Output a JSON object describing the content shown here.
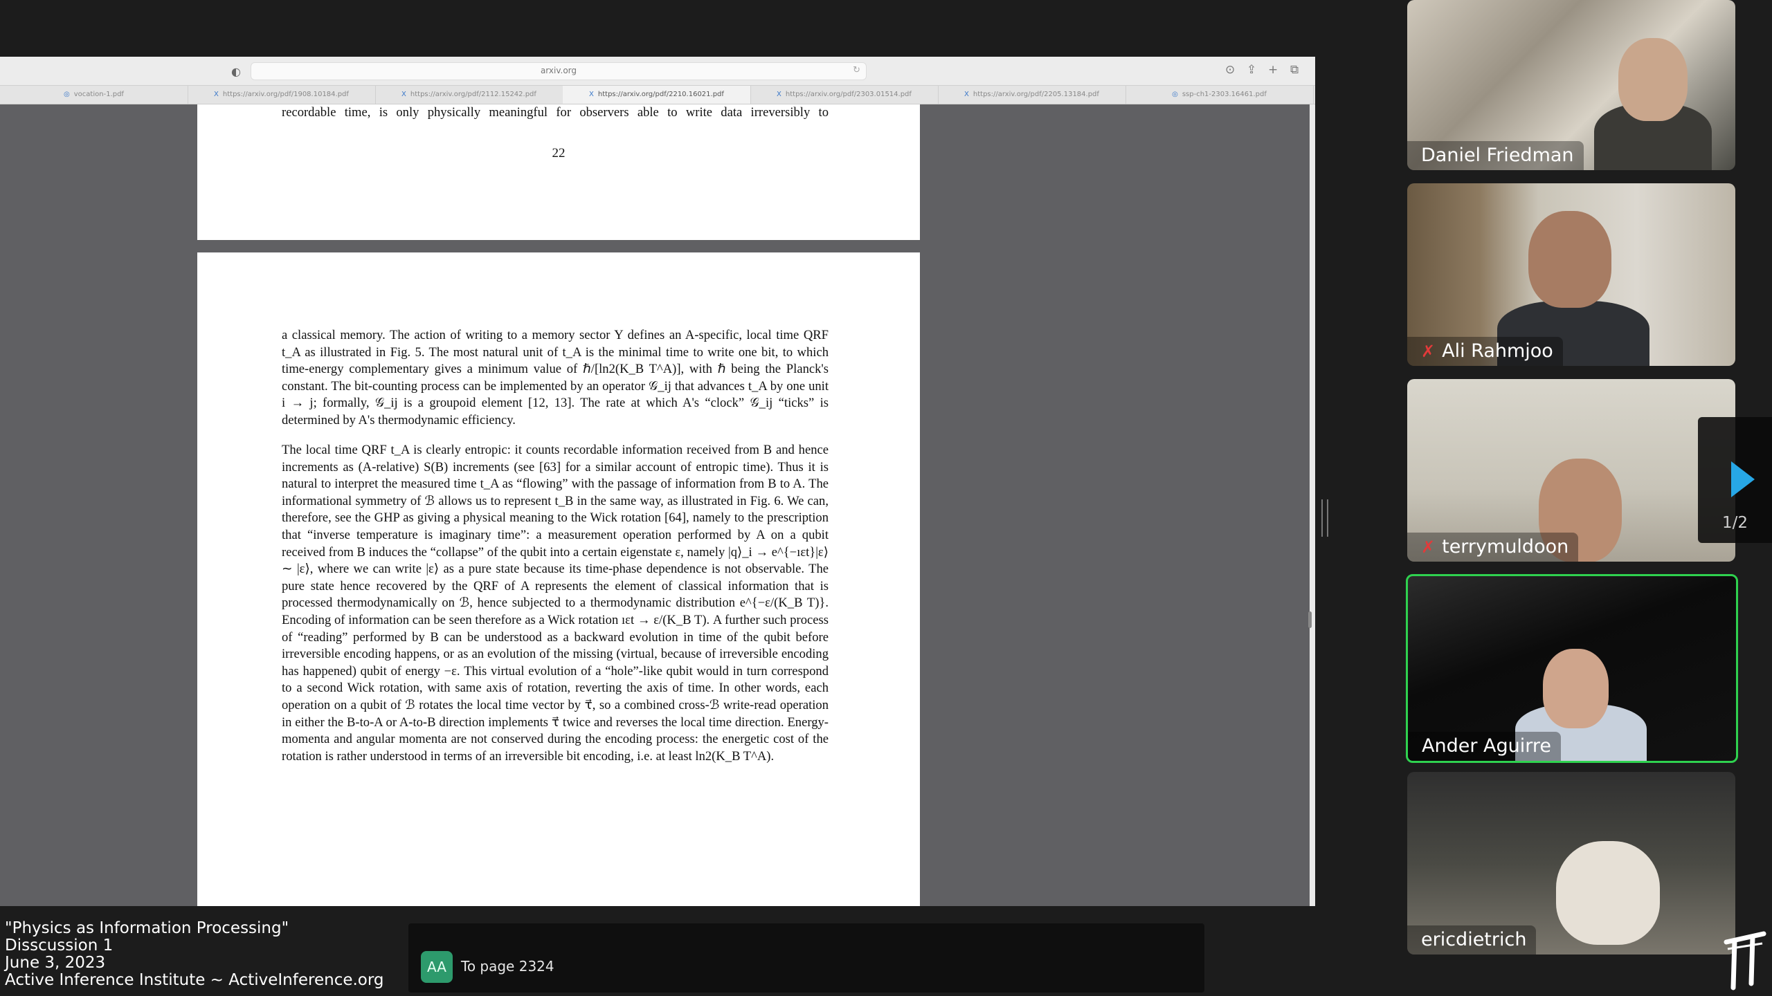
{
  "browser": {
    "url": "arxiv.org",
    "tabs": [
      {
        "label": "vocation-1.pdf"
      },
      {
        "label": "https://arxiv.org/pdf/1908.10184.pdf"
      },
      {
        "label": "https://arxiv.org/pdf/2112.15242.pdf"
      },
      {
        "label": "https://arxiv.org/pdf/2210.16021.pdf"
      },
      {
        "label": "https://arxiv.org/pdf/2303.01514.pdf"
      },
      {
        "label": "https://arxiv.org/pdf/2205.13184.pdf"
      },
      {
        "label": "ssp-ch1-2303.16461.pdf"
      }
    ],
    "active_tab": 3
  },
  "document": {
    "prev_page_last_line": "recordable time, is only physically meaningful for observers able to write data irreversibly to",
    "prev_page_number": "22",
    "paragraph1": "a classical memory. The action of writing to a memory sector Y defines an A-specific, local time QRF t_A as illustrated in Fig. 5. The most natural unit of t_A is the minimal time to write one bit, to which time-energy complementary gives a minimum value of ℏ/[ln2(K_B T^A)], with ℏ being the Planck's constant. The bit-counting process can be implemented by an operator 𝒢_ij that advances t_A by one unit i → j; formally, 𝒢_ij is a groupoid element [12, 13]. The rate at which A's “clock” 𝒢_ij “ticks” is determined by A's thermodynamic efficiency.",
    "paragraph2": "The local time QRF t_A is clearly entropic: it counts recordable information received from B and hence increments as (A-relative) S(B) increments (see [63] for a similar account of entropic time). Thus it is natural to interpret the measured time t_A as “flowing” with the passage of information from B to A. The informational symmetry of ℬ allows us to represent t_B in the same way, as illustrated in Fig. 6. We can, therefore, see the GHP as giving a physical meaning to the Wick rotation [64], namely to the prescription that “inverse temperature is imaginary time”: a measurement operation performed by A on a qubit received from B induces the “collapse” of the qubit into a certain eigenstate ε, namely |q⟩_i → e^{−ıεt}|ε⟩ ∼ |ε⟩, where we can write |ε⟩ as a pure state because its time-phase dependence is not observable. The pure state hence recovered by the QRF of A represents the element of classical information that is processed thermodynamically on ℬ, hence subjected to a thermodynamic distribution e^{−ε/(K_B T)}. Encoding of information can be seen therefore as a Wick rotation ıεt → ε/(K_B T). A further such process of “reading” performed by B can be understood as a backward evolution in time of the qubit before irreversible encoding happens, or as an evolution of the missing (virtual, because of irreversible encoding has happened) qubit of energy −ε. This virtual evolution of a “hole”-like qubit would in turn correspond to a second Wick rotation, with same axis of rotation, reverting the axis of time. In other words, each operation on a qubit of ℬ rotates the local time vector by τ⃗, so a combined cross-ℬ write-read operation in either the B-to-A or A-to-B direction implements τ⃗ twice and reverses the local time direction. Energy-momenta and angular momenta are not conserved during the encoding process: the energetic cost of the rotation is rather understood in terms of an irreversible bit encoding, i.e. at least ln2(K_B T^A)."
  },
  "caption": {
    "line1": "\"Physics as Information Processing\"",
    "line2": "Disscussion 1",
    "line3": "June 3, 2023",
    "line4": "Active Inference Institute ~ ActiveInference.org"
  },
  "chat": {
    "avatar_initials": "AA",
    "message": "To page 2324"
  },
  "participants": [
    {
      "name": "Daniel Friedman",
      "muted": false
    },
    {
      "name": "Ali Rahmjoo",
      "muted": true
    },
    {
      "name": "terrymuldoon",
      "muted": true
    },
    {
      "name": "Ander Aguirre",
      "muted": false,
      "speaking": true
    },
    {
      "name": "ericdietrich",
      "muted": false
    }
  ],
  "pager": {
    "label": "1/2"
  },
  "colors": {
    "speaking_border": "#2fd24f",
    "pager_arrow": "#27a7e6",
    "mute_icon": "#e23a3a",
    "chat_avatar": "#2d9a6c"
  }
}
